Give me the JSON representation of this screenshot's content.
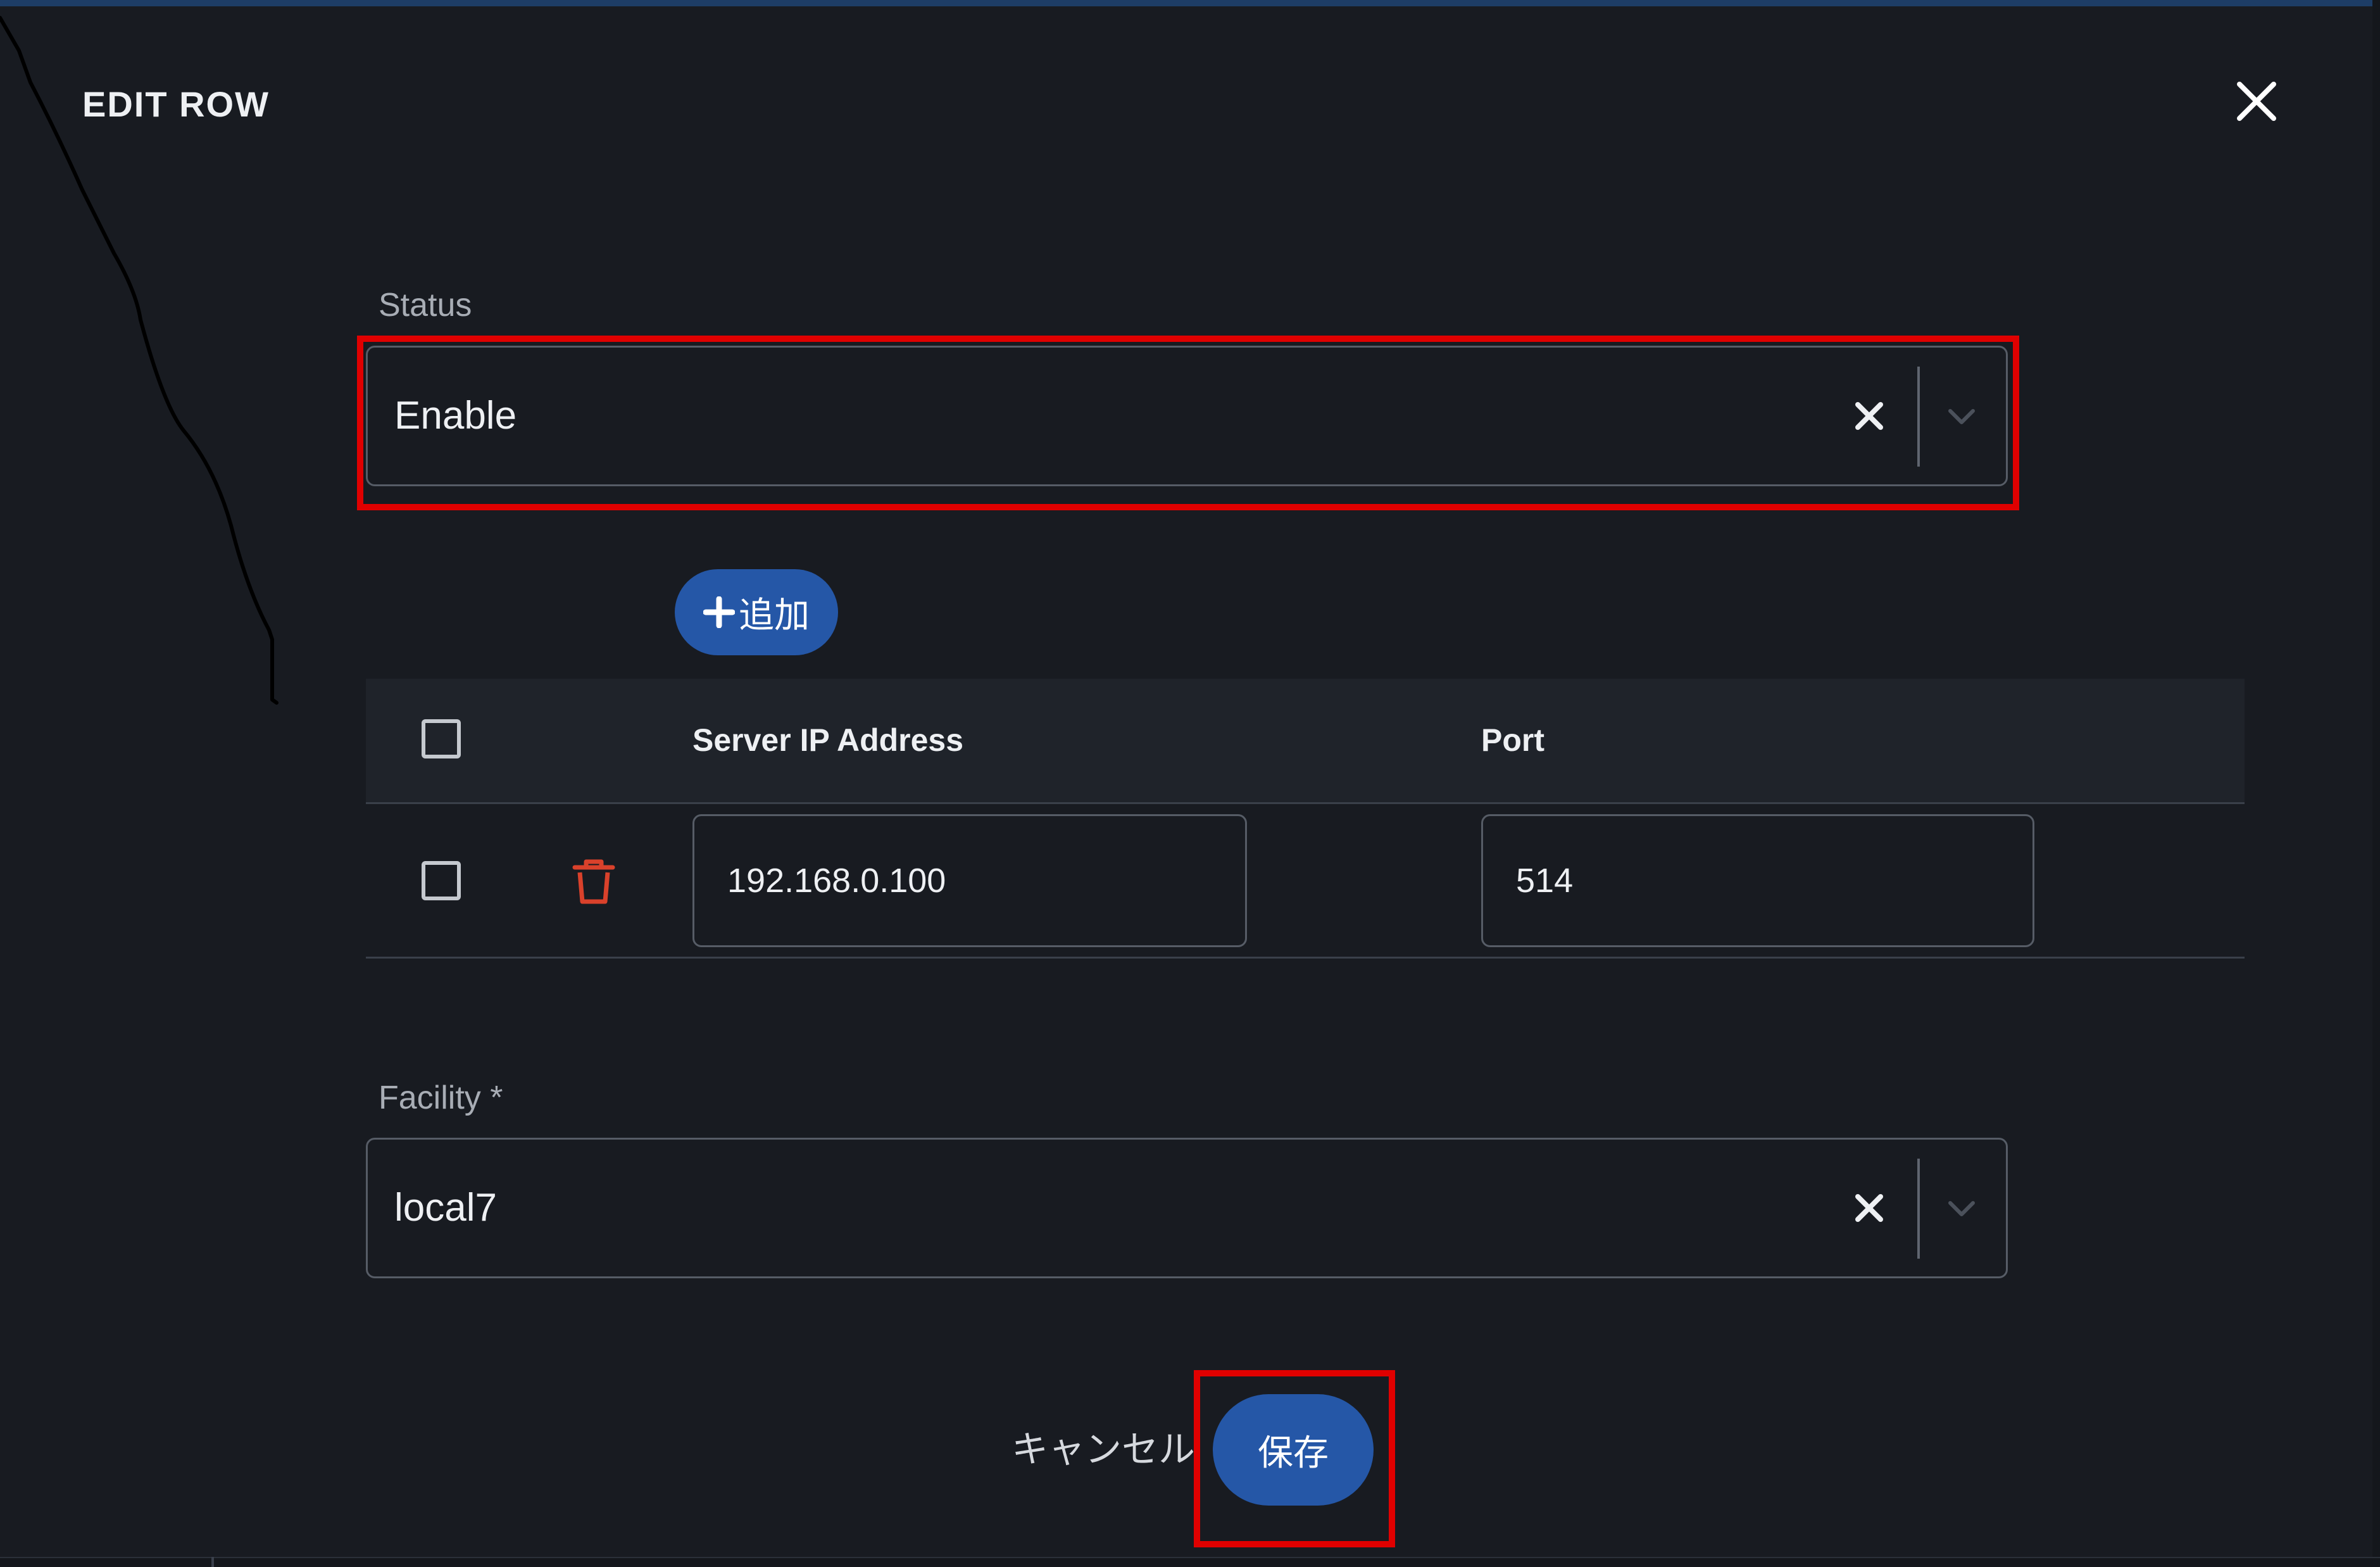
{
  "dialog": {
    "title": "EDIT ROW"
  },
  "status_field": {
    "label": "Status",
    "value": "Enable"
  },
  "add_button": {
    "icon": "plus-icon",
    "label": "追加"
  },
  "table": {
    "columns": [
      "Server IP Address",
      "Port"
    ],
    "rows": [
      {
        "ip": "192.168.0.100",
        "port": "514",
        "checked": false
      }
    ]
  },
  "facility_field": {
    "label": "Facility *",
    "value": "local7"
  },
  "footer": {
    "cancel_label": "キャンセル",
    "save_label": "保存"
  },
  "colors": {
    "background": "#181b21",
    "accent": "#2557a7",
    "highlight": "#e00000",
    "delete": "#d9412b"
  }
}
